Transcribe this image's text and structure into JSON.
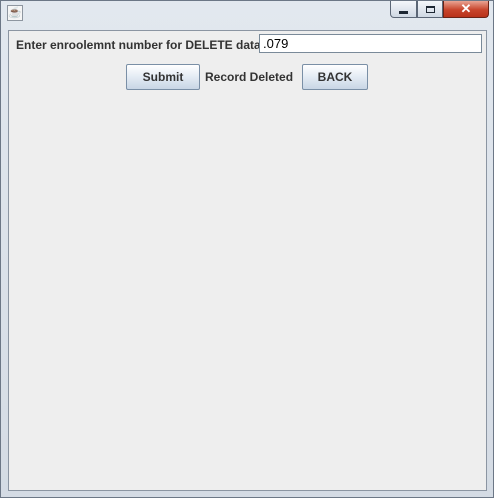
{
  "window": {
    "title": "",
    "icon": "java-cup-icon",
    "controls": {
      "minimize": "minimize",
      "maximize": "maximize",
      "close": "✕"
    }
  },
  "form": {
    "prompt_label": "Enter enroolemnt number for DELETE data",
    "enrollment_value": ".079",
    "submit_label": "Submit",
    "status_text": "Record Deleted",
    "back_label": "BACK"
  }
}
